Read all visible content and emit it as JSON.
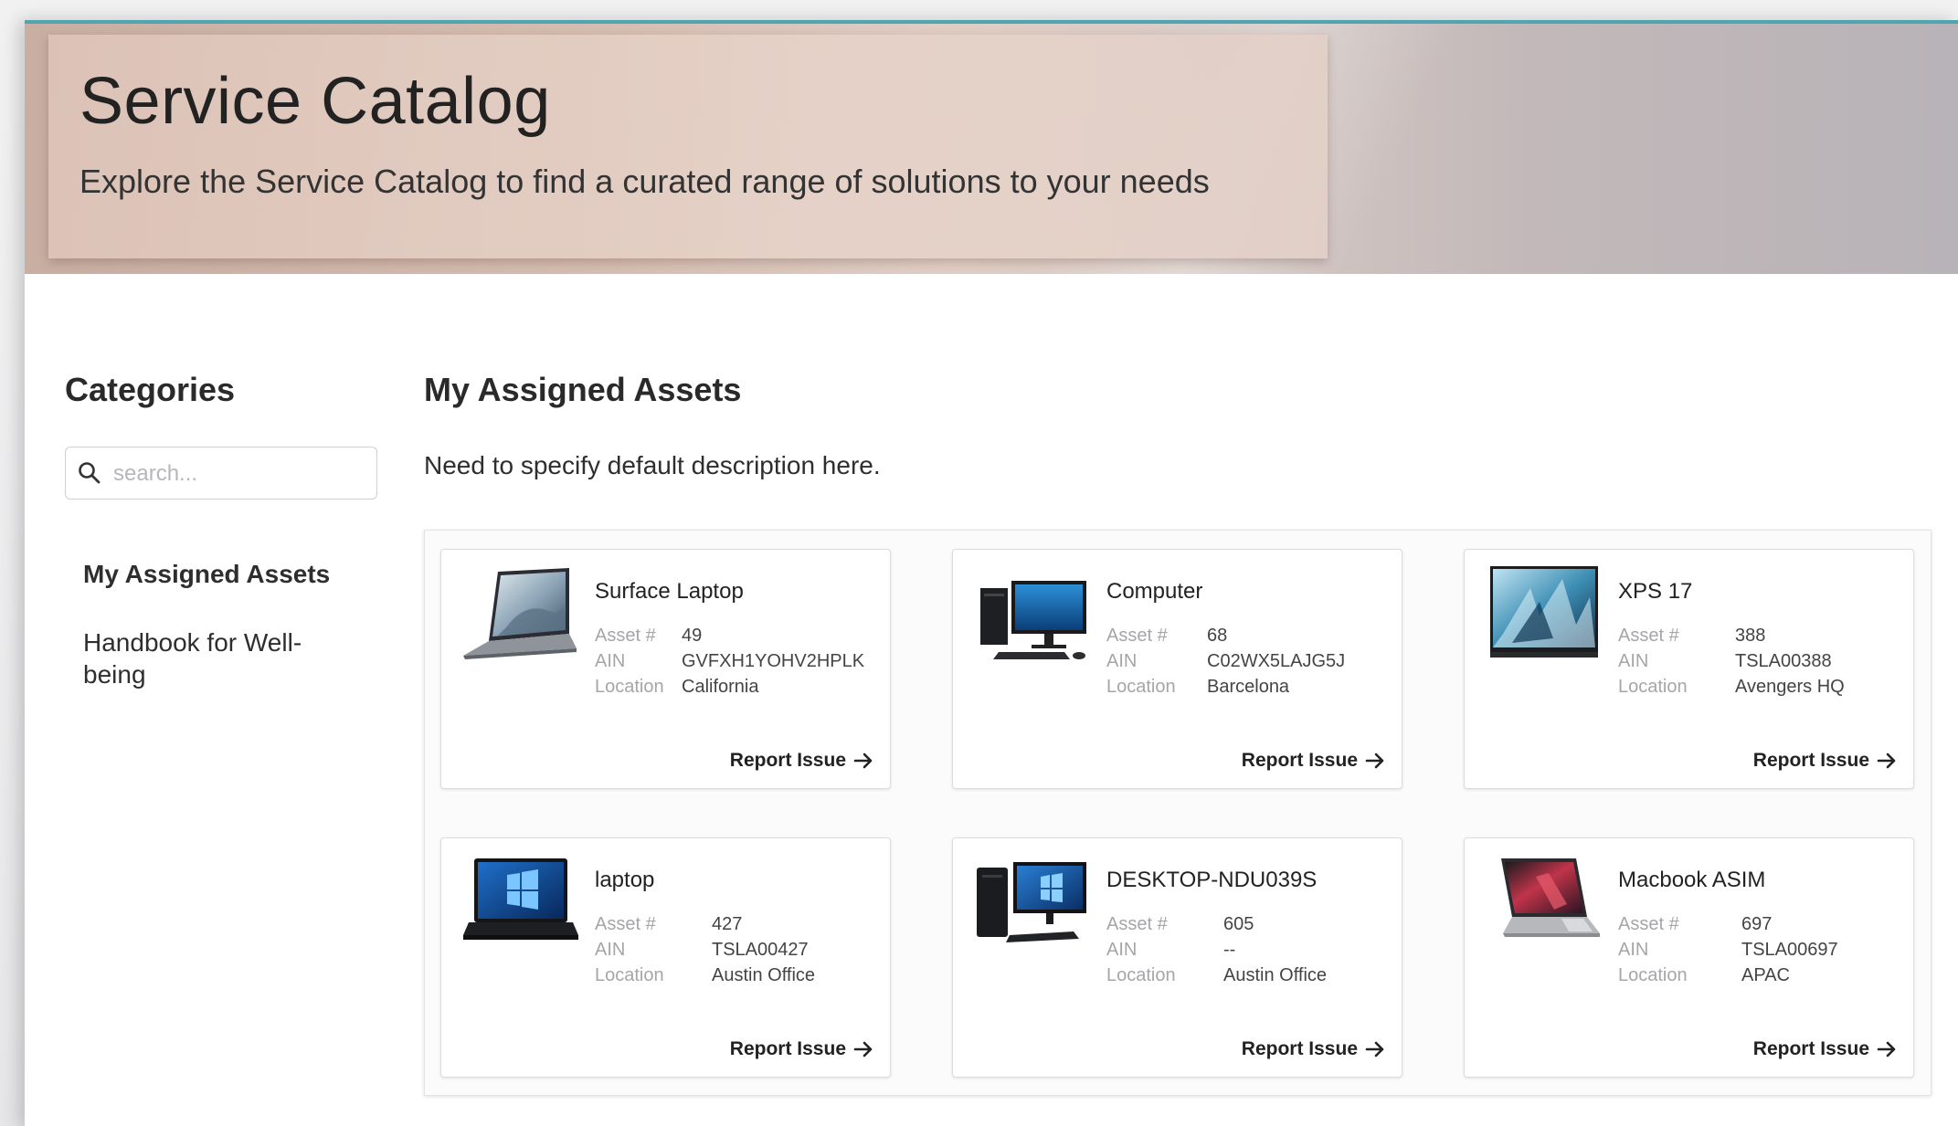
{
  "hero": {
    "title": "Service Catalog",
    "subtitle": "Explore the Service Catalog to find a curated range of solutions to your needs"
  },
  "sidebar": {
    "title": "Categories",
    "search_placeholder": "search...",
    "items": [
      {
        "label": "My Assigned Assets",
        "active": true
      },
      {
        "label": "Handbook for Well-being",
        "active": false
      }
    ]
  },
  "main": {
    "title": "My Assigned Assets",
    "description": "Need to specify default description here.",
    "field_labels": {
      "asset": "Asset #",
      "ain": "AIN",
      "location": "Location"
    },
    "action_label": "Report Issue",
    "assets": [
      {
        "name": "Surface Laptop",
        "asset_no": "49",
        "ain": "GVFXH1YOHV2HPLK",
        "location": "California",
        "icon": "surface-laptop-icon"
      },
      {
        "name": "Computer",
        "asset_no": "68",
        "ain": "C02WX5LAJG5J",
        "location": "Barcelona",
        "icon": "desktop-computer-icon"
      },
      {
        "name": "XPS 17",
        "asset_no": "388",
        "ain": "TSLA00388",
        "location": "Avengers HQ",
        "icon": "xps-laptop-icon"
      },
      {
        "name": "laptop",
        "asset_no": "427",
        "ain": "TSLA00427",
        "location": "Austin Office",
        "icon": "windows-laptop-icon"
      },
      {
        "name": "DESKTOP-NDU039S",
        "asset_no": "605",
        "ain": "--",
        "location": "Austin Office",
        "icon": "desktop-tower-icon"
      },
      {
        "name": "Macbook ASIM",
        "asset_no": "697",
        "ain": "TSLA00697",
        "location": "APAC",
        "icon": "macbook-icon"
      }
    ]
  },
  "colors": {
    "accent_line": "#4fa6b0",
    "text": "#222222",
    "muted_label": "#a5a5aa"
  }
}
